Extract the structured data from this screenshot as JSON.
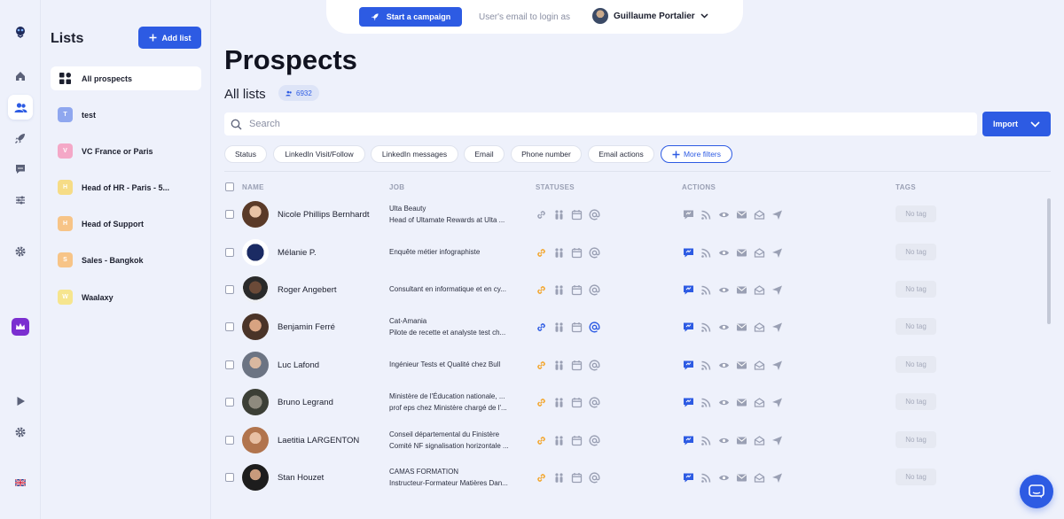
{
  "colors": {
    "primary": "#2d5be3",
    "link_orange": "#f3a52a",
    "text_dark": "#1c1f2e",
    "muted": "#9aa0b4"
  },
  "rail": {
    "items": [
      "logo-icon",
      "home-icon",
      "users-icon",
      "rocket-icon",
      "messages-icon",
      "sliders-icon",
      "gear-icon",
      "crown-icon",
      "play-icon",
      "gear-icon",
      "flag-icon"
    ]
  },
  "lists_panel": {
    "title": "Lists",
    "add_label": "Add list",
    "items": [
      {
        "label": "All prospects",
        "initial": ""
      },
      {
        "label": "test",
        "initial": "T"
      },
      {
        "label": "VC France or Paris",
        "initial": "V"
      },
      {
        "label": "Head of HR - Paris - 5...",
        "initial": "H"
      },
      {
        "label": "Head of Support",
        "initial": "H"
      },
      {
        "label": "Sales - Bangkok",
        "initial": "S"
      },
      {
        "label": "Waalaxy",
        "initial": "W"
      }
    ]
  },
  "topbar": {
    "campaign_label": "Start a campaign",
    "login_as": "User's email to login as",
    "user_name": "Guillaume Portalier"
  },
  "main": {
    "title": "Prospects",
    "subtitle": "All lists",
    "count": "6932",
    "search_placeholder": "Search",
    "import_label": "Import",
    "filters": [
      "Status",
      "LinkedIn Visit/Follow",
      "LinkedIn messages",
      "Email",
      "Phone number",
      "Email actions"
    ],
    "more_filters": "More filters",
    "columns": {
      "name": "NAME",
      "job": "JOB",
      "statuses": "STATUSES",
      "actions": "ACTIONS",
      "tags": "TAGS"
    }
  },
  "rows": [
    {
      "name": "Nicole Phillips Bernhardt",
      "job1": "Ulta Beauty",
      "job2": "Head of Ultamate Rewards at Ulta ...",
      "tag": "No tag",
      "link_active": false,
      "email_active": false
    },
    {
      "name": "Mélanie P.",
      "job1": "Enquête métier infographiste",
      "job2": "",
      "tag": "No tag",
      "link_active": true,
      "email_active": false
    },
    {
      "name": "Roger Angebert",
      "job1": "Consultant en informatique et en cy...",
      "job2": "",
      "tag": "No tag",
      "link_active": true,
      "email_active": false
    },
    {
      "name": "Benjamin Ferré",
      "job1": "Cat-Amania",
      "job2": "Pilote de recette et analyste test ch...",
      "tag": "No tag",
      "link_active": "blue",
      "email_active": true
    },
    {
      "name": "Luc Lafond",
      "job1": "Ingénieur Tests et Qualité chez Bull",
      "job2": "",
      "tag": "No tag",
      "link_active": true,
      "email_active": false
    },
    {
      "name": "Bruno Legrand",
      "job1": "Ministère de l'Éducation nationale, ...",
      "job2": "prof eps chez Ministère chargé de l'...",
      "tag": "No tag",
      "link_active": true,
      "email_active": false
    },
    {
      "name": "Laetitia LARGENTON",
      "job1": "Conseil départemental du Finistère",
      "job2": "Comité NF signalisation horizontale ...",
      "tag": "No tag",
      "link_active": true,
      "email_active": false
    },
    {
      "name": "Stan Houzet",
      "job1": "CAMAS FORMATION",
      "job2": "Instructeur-Formateur Matières Dan...",
      "tag": "No tag",
      "link_active": true,
      "email_active": false
    }
  ]
}
